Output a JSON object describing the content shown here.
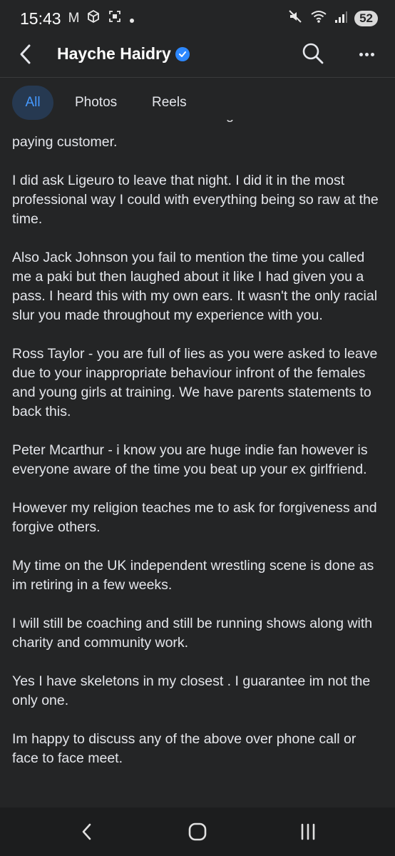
{
  "status_bar": {
    "time": "15:43",
    "notification_glyphs": "M",
    "battery_level": "52"
  },
  "header": {
    "title": "Hayche Haidry"
  },
  "tabs": [
    {
      "label": "All",
      "selected": true
    },
    {
      "label": "Photos",
      "selected": false
    },
    {
      "label": "Reels",
      "selected": false
    }
  ],
  "post": {
    "clipped_fragment": "g",
    "paragraphs": [
      "paying customer.",
      "I did ask Ligeuro to leave that night. I did it in the most professional way I could with everything being so raw at the time.",
      "Also Jack Johnson you fail to mention the time you called me a paki but then laughed about it like I had given you a pass. I heard this with my own ears. It wasn't the only racial slur you made throughout my experience with you.",
      "Ross Taylor - you are full of lies as you were asked to leave due to your inappropriate behaviour infront of the females and young girls at training. We have parents statements to back this.",
      "Peter Mcarthur - i know you are huge indie fan however is everyone aware of the time you beat up your ex girlfriend.",
      "However my religion teaches me to ask for forgiveness and forgive others.",
      "My time on the UK independent wrestling scene is done as im retiring in a few weeks.",
      "I will still be coaching and still be running shows along with charity and community work.",
      "Yes I have skeletons in my closest . I guarantee im not the only one.",
      "Im happy to discuss any of the above over phone call or face to face meet."
    ]
  },
  "colors": {
    "background": "#242526",
    "text": "#e4e6eb",
    "accent": "#4599ff",
    "selected_tab_bg": "#263951",
    "verified": "#2d88ff"
  }
}
